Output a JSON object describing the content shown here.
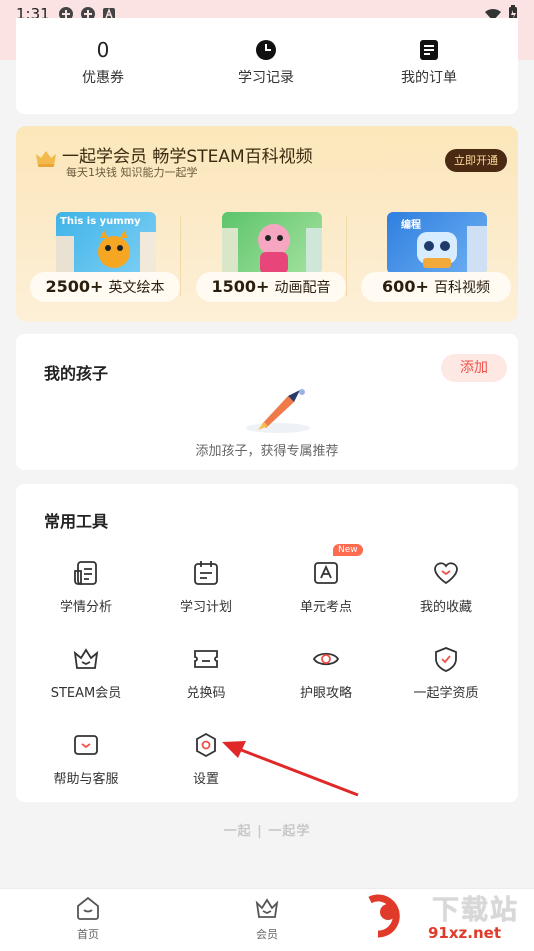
{
  "status_bar": {
    "time": "1:31"
  },
  "stats": [
    {
      "value": "0",
      "label": "优惠券"
    },
    {
      "icon": "clock-icon",
      "label": "学习记录"
    },
    {
      "icon": "order-icon",
      "label": "我的订单"
    }
  ],
  "banner": {
    "title": "一起学会员 畅学STEAM百科视频",
    "subtitle": "每天1块钱 知识能力一起学",
    "cta": "立即开通",
    "features": [
      {
        "count": "2500+",
        "text": "英文绘本",
        "thumb_caption": "This is yummy"
      },
      {
        "count": "1500+",
        "text": "动画配音",
        "thumb_caption": ""
      },
      {
        "count": "600+",
        "text": "百科视频",
        "thumb_caption": "编程"
      }
    ]
  },
  "kids": {
    "title": "我的孩子",
    "add_label": "添加",
    "hint": "添加孩子，获得专属推荐"
  },
  "tools": {
    "title": "常用工具",
    "new_badge": "New",
    "items": [
      {
        "label": "学情分析",
        "icon": "report-icon"
      },
      {
        "label": "学习计划",
        "icon": "calendar-icon"
      },
      {
        "label": "单元考点",
        "icon": "exam-icon"
      },
      {
        "label": "我的收藏",
        "icon": "heart-icon"
      },
      {
        "label": "STEAM会员",
        "icon": "crown-icon"
      },
      {
        "label": "兑换码",
        "icon": "ticket-icon"
      },
      {
        "label": "护眼攻略",
        "icon": "eye-icon"
      },
      {
        "label": "一起学资质",
        "icon": "shield-icon"
      },
      {
        "label": "帮助与客服",
        "icon": "help-icon"
      },
      {
        "label": "设置",
        "icon": "gear-icon"
      }
    ]
  },
  "brand": "一起 | 一起学",
  "bottom_nav": [
    {
      "label": "首页",
      "icon": "home-icon"
    },
    {
      "label": "会员",
      "icon": "crown-icon"
    }
  ],
  "watermark": {
    "text": "下载站",
    "url": "91xz.net",
    "mark": "9"
  },
  "colors": {
    "accent": "#f0524a",
    "banner_dark": "#4a2a12",
    "arrow": "#e02828"
  }
}
